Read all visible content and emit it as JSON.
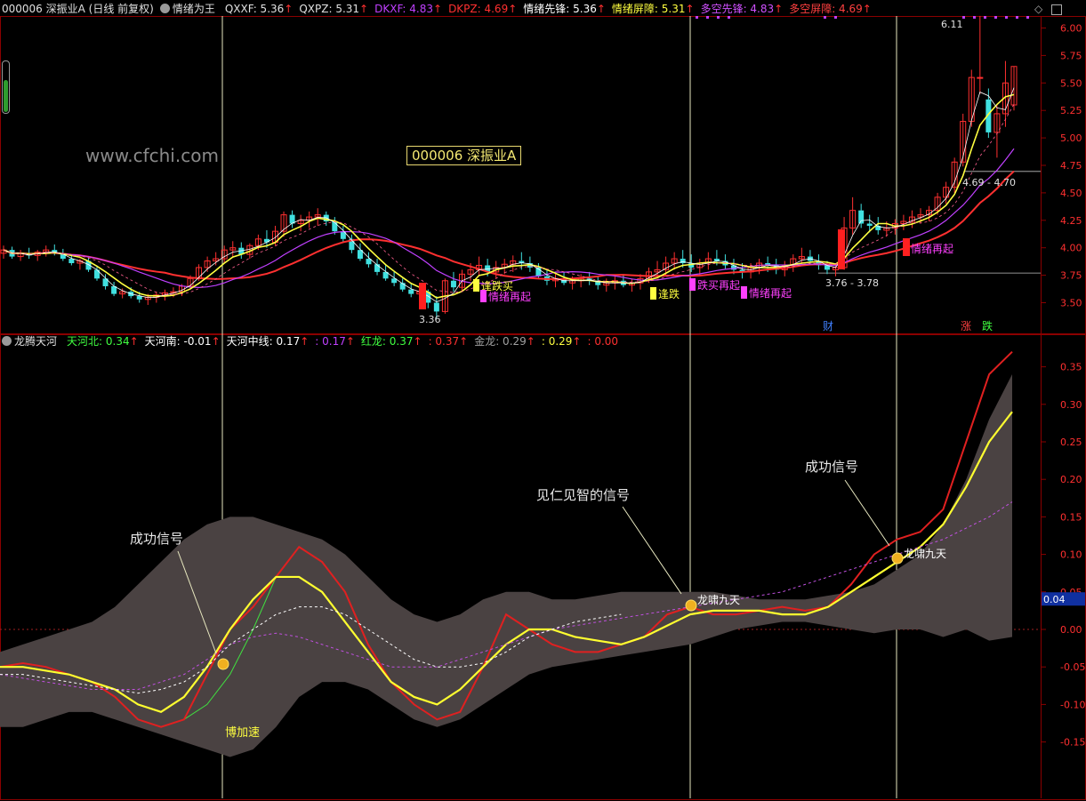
{
  "header": {
    "title": "000006 深振业A (日线 前复权)",
    "indicator_name": "情绪为王",
    "items": [
      {
        "label": "QXXF: 5.36",
        "color": "#e0e0e0",
        "arrow": "↑"
      },
      {
        "label": "QXPZ: 5.31",
        "color": "#e0e0e0",
        "arrow": "↑"
      },
      {
        "label": "DKXF: 4.83",
        "color": "#c040ff",
        "arrow": "↑"
      },
      {
        "label": "DKPZ: 4.69",
        "color": "#ff3030",
        "arrow": "↑"
      },
      {
        "label": "情绪先锋: 5.36",
        "color": "#ffffff",
        "arrow": "↑"
      },
      {
        "label": "情绪屏障: 5.31",
        "color": "#ffff40",
        "arrow": "↑"
      },
      {
        "label": "多空先锋: 4.83",
        "color": "#d050ff",
        "arrow": "↑"
      },
      {
        "label": "多空屏障: 4.69",
        "color": "#ff4040",
        "arrow": "↑"
      }
    ]
  },
  "watermark": "www.cfchi.com",
  "stock_box": "000006 深振业A",
  "lower_header": {
    "indicator_name": "龙腾天河",
    "items": [
      {
        "label": "天河北: 0.34",
        "color": "#40ff40",
        "arrow": "↑"
      },
      {
        "label": "天河南: -0.01",
        "color": "#ffffff",
        "arrow": "↑"
      },
      {
        "label": "天河中线: 0.17",
        "color": "#ffffff",
        "arrow": "↑"
      },
      {
        "label": ": 0.17",
        "color": "#c040ff",
        "arrow": "↑"
      },
      {
        "label": "红龙: 0.37",
        "color": "#40ff40",
        "arrow": "↑"
      },
      {
        "label": ": 0.37",
        "color": "#ff3030",
        "arrow": "↑"
      },
      {
        "label": "金龙: 0.29",
        "color": "#a0a0a0",
        "arrow": "↑"
      },
      {
        "label": ": 0.29",
        "color": "#ffff40",
        "arrow": "↑"
      },
      {
        "label": ": 0.00",
        "color": "#ff3030",
        "arrow": ""
      }
    ]
  },
  "upper_axis": {
    "ticks": [
      "6.00",
      "5.75",
      "5.50",
      "5.25",
      "5.00",
      "4.75",
      "4.50",
      "4.25",
      "4.00",
      "3.75",
      "3.50"
    ],
    "ylim": [
      3.35,
      6.2
    ]
  },
  "lower_axis": {
    "ticks": [
      "0.35",
      "0.30",
      "0.25",
      "0.20",
      "0.15",
      "0.10",
      "0.05",
      "0.00",
      "-0.05",
      "-0.10",
      "-0.15"
    ],
    "ylim": [
      -0.21,
      0.38
    ],
    "current_value": "0.04"
  },
  "chart_data": [
    {
      "type": "candlestick",
      "title": "000006 深振业A (日线 前复权)",
      "ylim": [
        3.35,
        6.2
      ],
      "candles": [
        [
          3.95,
          4.02,
          3.9,
          3.98
        ],
        [
          3.98,
          4.01,
          3.9,
          3.92
        ],
        [
          3.92,
          3.98,
          3.88,
          3.95
        ],
        [
          3.95,
          4.0,
          3.9,
          3.93
        ],
        [
          3.93,
          3.98,
          3.88,
          3.96
        ],
        [
          3.96,
          4.02,
          3.92,
          3.98
        ],
        [
          3.98,
          4.03,
          3.93,
          3.95
        ],
        [
          3.95,
          3.99,
          3.88,
          3.9
        ],
        [
          3.9,
          3.94,
          3.84,
          3.86
        ],
        [
          3.86,
          3.9,
          3.8,
          3.88
        ],
        [
          3.88,
          3.92,
          3.78,
          3.8
        ],
        [
          3.8,
          3.84,
          3.7,
          3.72
        ],
        [
          3.72,
          3.76,
          3.62,
          3.65
        ],
        [
          3.65,
          3.69,
          3.56,
          3.58
        ],
        [
          3.58,
          3.63,
          3.54,
          3.6
        ],
        [
          3.6,
          3.64,
          3.54,
          3.56
        ],
        [
          3.56,
          3.6,
          3.5,
          3.53
        ],
        [
          3.53,
          3.58,
          3.48,
          3.55
        ],
        [
          3.55,
          3.6,
          3.5,
          3.57
        ],
        [
          3.57,
          3.62,
          3.52,
          3.59
        ],
        [
          3.59,
          3.64,
          3.55,
          3.6
        ],
        [
          3.6,
          3.67,
          3.56,
          3.65
        ],
        [
          3.65,
          3.75,
          3.62,
          3.72
        ],
        [
          3.72,
          3.85,
          3.7,
          3.82
        ],
        [
          3.82,
          3.92,
          3.78,
          3.88
        ],
        [
          3.88,
          3.96,
          3.84,
          3.9
        ],
        [
          3.9,
          4.02,
          3.86,
          3.98
        ],
        [
          3.98,
          4.06,
          3.92,
          4.0
        ],
        [
          4.0,
          4.05,
          3.9,
          3.94
        ],
        [
          3.94,
          4.04,
          3.9,
          4.02
        ],
        [
          4.02,
          4.12,
          3.98,
          4.08
        ],
        [
          4.08,
          4.16,
          4.0,
          4.05
        ],
        [
          4.05,
          4.2,
          4.02,
          4.15
        ],
        [
          4.15,
          4.33,
          4.1,
          4.3
        ],
        [
          4.3,
          4.34,
          4.18,
          4.22
        ],
        [
          4.22,
          4.3,
          4.15,
          4.25
        ],
        [
          4.25,
          4.33,
          4.18,
          4.28
        ],
        [
          4.28,
          4.36,
          4.2,
          4.3
        ],
        [
          4.3,
          4.33,
          4.2,
          4.24
        ],
        [
          4.24,
          4.28,
          4.12,
          4.15
        ],
        [
          4.15,
          4.2,
          4.05,
          4.08
        ],
        [
          4.08,
          4.12,
          3.95,
          3.98
        ],
        [
          3.98,
          4.04,
          3.88,
          3.9
        ],
        [
          3.9,
          3.96,
          3.82,
          3.85
        ],
        [
          3.85,
          3.9,
          3.75,
          3.78
        ],
        [
          3.78,
          3.84,
          3.7,
          3.72
        ],
        [
          3.72,
          3.78,
          3.65,
          3.68
        ],
        [
          3.68,
          3.72,
          3.6,
          3.62
        ],
        [
          3.62,
          3.68,
          3.55,
          3.58
        ],
        [
          3.58,
          3.64,
          3.52,
          3.6
        ],
        [
          3.6,
          3.62,
          3.45,
          3.5
        ],
        [
          3.5,
          3.56,
          3.36,
          3.42
        ],
        [
          3.42,
          3.72,
          3.4,
          3.7
        ],
        [
          3.7,
          3.78,
          3.6,
          3.64
        ],
        [
          3.64,
          3.8,
          3.6,
          3.76
        ],
        [
          3.76,
          3.86,
          3.7,
          3.8
        ],
        [
          3.8,
          3.92,
          3.75,
          3.84
        ],
        [
          3.84,
          3.9,
          3.74,
          3.78
        ],
        [
          3.78,
          3.88,
          3.72,
          3.82
        ],
        [
          3.82,
          3.9,
          3.76,
          3.85
        ],
        [
          3.85,
          3.93,
          3.78,
          3.88
        ],
        [
          3.88,
          3.96,
          3.8,
          3.86
        ],
        [
          3.86,
          3.92,
          3.78,
          3.82
        ],
        [
          3.82,
          3.86,
          3.72,
          3.74
        ],
        [
          3.74,
          3.8,
          3.66,
          3.7
        ],
        [
          3.7,
          3.76,
          3.64,
          3.72
        ],
        [
          3.72,
          3.78,
          3.66,
          3.68
        ],
        [
          3.68,
          3.74,
          3.62,
          3.7
        ],
        [
          3.7,
          3.76,
          3.64,
          3.72
        ],
        [
          3.72,
          3.78,
          3.66,
          3.7
        ],
        [
          3.7,
          3.74,
          3.62,
          3.66
        ],
        [
          3.66,
          3.72,
          3.6,
          3.68
        ],
        [
          3.68,
          3.74,
          3.62,
          3.7
        ],
        [
          3.7,
          3.76,
          3.64,
          3.66
        ],
        [
          3.66,
          3.72,
          3.6,
          3.68
        ],
        [
          3.68,
          3.76,
          3.62,
          3.72
        ],
        [
          3.72,
          3.82,
          3.68,
          3.78
        ],
        [
          3.78,
          3.88,
          3.72,
          3.8
        ],
        [
          3.8,
          3.92,
          3.74,
          3.86
        ],
        [
          3.86,
          3.96,
          3.8,
          3.9
        ],
        [
          3.9,
          3.98,
          3.82,
          3.86
        ],
        [
          3.86,
          3.94,
          3.78,
          3.82
        ],
        [
          3.82,
          3.9,
          3.74,
          3.86
        ],
        [
          3.86,
          3.96,
          3.8,
          3.9
        ],
        [
          3.9,
          3.98,
          3.84,
          3.88
        ],
        [
          3.88,
          3.94,
          3.8,
          3.84
        ],
        [
          3.84,
          3.9,
          3.76,
          3.8
        ],
        [
          3.8,
          3.86,
          3.72,
          3.78
        ],
        [
          3.78,
          3.86,
          3.72,
          3.82
        ],
        [
          3.82,
          3.9,
          3.76,
          3.86
        ],
        [
          3.86,
          3.92,
          3.78,
          3.84
        ],
        [
          3.84,
          3.9,
          3.76,
          3.8
        ],
        [
          3.8,
          3.88,
          3.74,
          3.84
        ],
        [
          3.84,
          3.94,
          3.78,
          3.9
        ],
        [
          3.9,
          4.0,
          3.84,
          3.92
        ],
        [
          3.92,
          3.98,
          3.84,
          3.88
        ],
        [
          3.88,
          3.94,
          3.8,
          3.84
        ],
        [
          3.84,
          3.88,
          3.76,
          3.8
        ],
        [
          3.8,
          3.86,
          3.74,
          3.82
        ],
        [
          3.82,
          4.28,
          3.8,
          4.18
        ],
        [
          4.18,
          4.46,
          4.12,
          4.34
        ],
        [
          4.34,
          4.4,
          4.18,
          4.22
        ],
        [
          4.22,
          4.3,
          4.14,
          4.2
        ],
        [
          4.2,
          4.28,
          4.12,
          4.16
        ],
        [
          4.16,
          4.24,
          4.1,
          4.18
        ],
        [
          4.18,
          4.26,
          4.12,
          4.22
        ],
        [
          4.22,
          4.3,
          4.16,
          4.24
        ],
        [
          4.24,
          4.34,
          4.18,
          4.28
        ],
        [
          4.28,
          4.36,
          4.22,
          4.3
        ],
        [
          4.3,
          4.38,
          4.24,
          4.34
        ],
        [
          4.34,
          4.5,
          4.3,
          4.46
        ],
        [
          4.46,
          4.6,
          4.4,
          4.55
        ],
        [
          4.55,
          4.82,
          4.5,
          4.78
        ],
        [
          4.78,
          5.22,
          4.74,
          5.15
        ],
        [
          5.15,
          5.62,
          5.1,
          5.55
        ],
        [
          5.55,
          6.11,
          5.4,
          5.55
        ],
        [
          5.35,
          5.45,
          5.0,
          5.05
        ],
        [
          5.05,
          5.3,
          4.82,
          5.22
        ],
        [
          5.22,
          5.7,
          5.1,
          5.5
        ],
        [
          5.3,
          5.65,
          5.25,
          5.65
        ]
      ]
    },
    {
      "type": "line",
      "title": "龙腾天河",
      "ylim": [
        -0.21,
        0.38
      ],
      "series": [
        {
          "name": "天河北",
          "values": [
            -0.05,
            -0.045,
            -0.05,
            -0.06,
            -0.07,
            -0.09,
            -0.12,
            -0.13,
            -0.12,
            -0.1,
            -0.06,
            0.0,
            0.07,
            0.11,
            0.09,
            0.05,
            -0.02,
            -0.07,
            -0.1,
            -0.12,
            -0.11,
            -0.05,
            0.02,
            0.0,
            -0.02,
            -0.03,
            -0.03,
            -0.02,
            -0.01,
            0.02,
            0.03,
            0.02,
            0.02,
            0.025,
            0.03,
            0.025,
            0.03,
            0.06,
            0.1,
            0.12,
            0.13,
            0.16,
            0.25,
            0.34,
            0.37
          ]
        },
        {
          "name": "红龙",
          "values": [
            -0.05,
            -0.045,
            -0.05,
            -0.06,
            -0.07,
            -0.09,
            -0.12,
            -0.13,
            -0.12,
            -0.06,
            0.0,
            0.03,
            0.07,
            0.11,
            0.09,
            0.05,
            -0.02,
            -0.07,
            -0.1,
            -0.12,
            -0.11,
            -0.05,
            0.02,
            0.0,
            -0.02,
            -0.03,
            -0.03,
            -0.02,
            -0.01,
            0.02,
            0.03,
            0.02,
            0.02,
            0.025,
            0.03,
            0.025,
            0.03,
            0.06,
            0.1,
            0.12,
            0.13,
            0.16,
            0.25,
            0.34,
            0.37
          ]
        },
        {
          "name": "金龙",
          "values": [
            -0.05,
            -0.05,
            -0.055,
            -0.06,
            -0.07,
            -0.08,
            -0.1,
            -0.11,
            -0.09,
            -0.05,
            0.0,
            0.04,
            0.07,
            0.07,
            0.05,
            0.01,
            -0.03,
            -0.07,
            -0.09,
            -0.1,
            -0.08,
            -0.05,
            -0.02,
            0.0,
            0.0,
            -0.01,
            -0.015,
            -0.02,
            -0.01,
            0.005,
            0.02,
            0.025,
            0.025,
            0.025,
            0.02,
            0.02,
            0.03,
            0.05,
            0.07,
            0.09,
            0.11,
            0.14,
            0.19,
            0.25,
            0.29
          ]
        },
        {
          "name": "天河中线",
          "values": [
            -0.06,
            -0.065,
            -0.07,
            -0.075,
            -0.08,
            -0.08,
            -0.08,
            -0.07,
            -0.06,
            -0.04,
            -0.02,
            -0.01,
            -0.005,
            -0.01,
            -0.02,
            -0.03,
            -0.04,
            -0.05,
            -0.05,
            -0.05,
            -0.04,
            -0.03,
            -0.02,
            -0.01,
            0.0,
            0.005,
            0.01,
            0.015,
            0.02,
            0.025,
            0.03,
            0.035,
            0.04,
            0.045,
            0.05,
            0.06,
            0.07,
            0.08,
            0.09,
            0.1,
            0.11,
            0.12,
            0.135,
            0.15,
            0.17
          ]
        }
      ],
      "band": {
        "upper": [
          -0.03,
          -0.02,
          -0.01,
          0.0,
          0.01,
          0.03,
          0.06,
          0.09,
          0.12,
          0.14,
          0.15,
          0.15,
          0.14,
          0.13,
          0.12,
          0.1,
          0.07,
          0.04,
          0.02,
          0.01,
          0.02,
          0.04,
          0.05,
          0.05,
          0.04,
          0.04,
          0.045,
          0.05,
          0.05,
          0.05,
          0.05,
          0.05,
          0.045,
          0.04,
          0.04,
          0.04,
          0.045,
          0.05,
          0.06,
          0.08,
          0.1,
          0.14,
          0.2,
          0.28,
          0.34
        ],
        "lower": [
          -0.13,
          -0.13,
          -0.12,
          -0.11,
          -0.11,
          -0.12,
          -0.13,
          -0.14,
          -0.15,
          -0.16,
          -0.17,
          -0.16,
          -0.13,
          -0.09,
          -0.07,
          -0.07,
          -0.08,
          -0.1,
          -0.12,
          -0.13,
          -0.12,
          -0.1,
          -0.08,
          -0.06,
          -0.05,
          -0.045,
          -0.04,
          -0.035,
          -0.03,
          -0.025,
          -0.02,
          -0.01,
          0.0,
          0.005,
          0.01,
          0.01,
          0.005,
          0.0,
          -0.005,
          0.0,
          0.0,
          -0.01,
          0.0,
          -0.015,
          -0.01
        ]
      },
      "annotations": [
        "成功信号",
        "见仁见智的信号",
        "成功信号",
        "博加速",
        "龙啸九天",
        "龙啸九天"
      ]
    }
  ],
  "price_marks": {
    "high": "6.11",
    "low": "3.36",
    "range_1": "3.76 - 3.78",
    "range_2": "4.69 - 4.70"
  },
  "signal_labels": [
    "逢跌买",
    "情绪再起",
    "逢跌",
    "跌买再起",
    "情绪再起",
    "情绪再起"
  ],
  "bottom_tags": [
    {
      "text": "财",
      "color": "#4080ff"
    },
    {
      "text": "涨",
      "color": "#ff4040"
    },
    {
      "text": "跌",
      "color": "#40ff40"
    }
  ],
  "lower_annotations": {
    "signal_1": "成功信号",
    "signal_2": "见仁见智的信号",
    "signal_3": "成功信号",
    "accelerate": "博加速",
    "dragon_1": "龙啸九天",
    "dragon_2": "龙啸九天"
  },
  "colors": {
    "up": "#ff3030",
    "down": "#40e0e0",
    "grid": "#8b0000",
    "axis_text": "#ff3030"
  }
}
